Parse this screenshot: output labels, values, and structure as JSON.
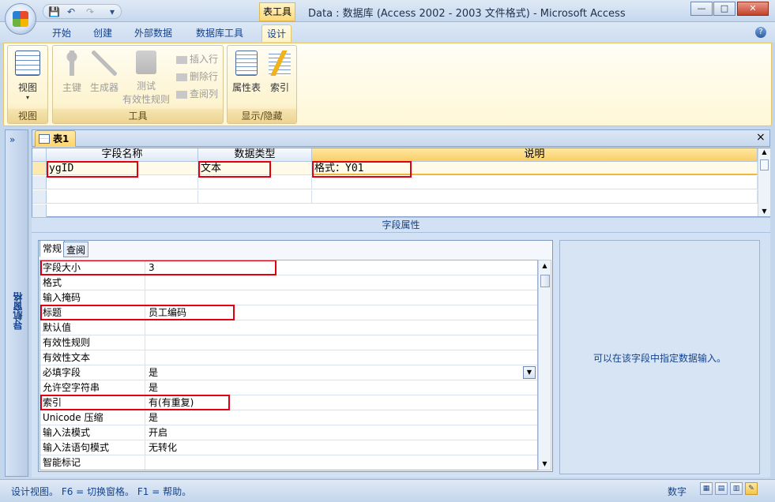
{
  "window": {
    "title": "Data : 数据库 (Access 2002 - 2003 文件格式) - Microsoft Access",
    "tool_tab": "表工具",
    "min": "—",
    "max": "□",
    "close": "✕"
  },
  "qat": {
    "save": "💾",
    "undo": "↶",
    "redo": "↷",
    "more": "▾"
  },
  "tabs": [
    "开始",
    "创建",
    "外部数据",
    "数据库工具",
    "设计"
  ],
  "help": "?",
  "ribbon": {
    "groups": {
      "view": "视图",
      "tools": "工具",
      "showhide": "显示/隐藏"
    },
    "view_btn": "视图",
    "view_arrow": "▾",
    "primary_key": "主键",
    "builder": "生成器",
    "test_rules_1": "测试",
    "test_rules_2": "有效性规则",
    "insert_row": "插入行",
    "delete_row": "删除行",
    "lookup_col": "查阅列",
    "property_sheet": "属性表",
    "indexes": "索引"
  },
  "nav": {
    "chevron": "»",
    "label": "导航窗格"
  },
  "doc": {
    "tab": "表1",
    "close": "×"
  },
  "grid": {
    "headers": [
      "字段名称",
      "数据类型",
      "说明"
    ],
    "rows": [
      {
        "name": "ygID",
        "type": "文本",
        "desc": "格式：Y01"
      }
    ]
  },
  "props_title": "字段属性",
  "prop_tabs": [
    "常规",
    "查阅"
  ],
  "properties": [
    {
      "name": "字段大小",
      "value": "3"
    },
    {
      "name": "格式",
      "value": ""
    },
    {
      "name": "输入掩码",
      "value": ""
    },
    {
      "name": "标题",
      "value": "员工编码"
    },
    {
      "name": "默认值",
      "value": ""
    },
    {
      "name": "有效性规则",
      "value": ""
    },
    {
      "name": "有效性文本",
      "value": ""
    },
    {
      "name": "必填字段",
      "value": "是"
    },
    {
      "name": "允许空字符串",
      "value": "是"
    },
    {
      "name": "索引",
      "value": "有(有重复)"
    },
    {
      "name": "Unicode 压缩",
      "value": "是"
    },
    {
      "name": "输入法模式",
      "value": "开启"
    },
    {
      "name": "输入法语句模式",
      "value": "无转化"
    },
    {
      "name": "智能标记",
      "value": ""
    }
  ],
  "dropdown_arrow": "▼",
  "help_text": "可以在该字段中指定数据输入。",
  "status": {
    "text": "设计视图。  F6 = 切换窗格。  F1 = 帮助。",
    "num": "数字"
  }
}
